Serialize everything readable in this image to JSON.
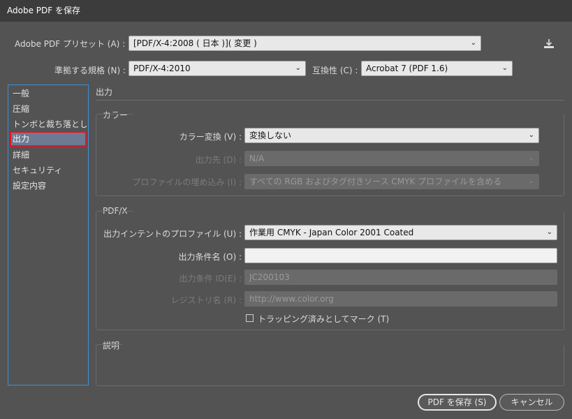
{
  "window": {
    "title": "Adobe PDF を保存"
  },
  "header": {
    "preset_label": "Adobe PDF プリセット (A) :",
    "preset_value": "[PDF/X-4:2008 ( 日本 )]( 変更 )",
    "standard_label": "準拠する規格 (N) :",
    "standard_value": "PDF/X-4:2010",
    "compat_label": "互換性 (C) :",
    "compat_value": "Acrobat 7 (PDF 1.6)",
    "save_preset_icon": "download-icon"
  },
  "sidebar": {
    "items": [
      {
        "label": "一般"
      },
      {
        "label": "圧縮"
      },
      {
        "label": "トンボと裁ち落とし"
      },
      {
        "label": "出力"
      },
      {
        "label": "詳細"
      },
      {
        "label": "セキュリティ"
      },
      {
        "label": "設定内容"
      }
    ],
    "active_index": 3
  },
  "main": {
    "section_title": "出力",
    "color": {
      "title": "カラー",
      "conversion_label": "カラー変換 (V) :",
      "conversion_value": "変換しない",
      "destination_label": "出力先 (D) :",
      "destination_value": "N/A",
      "profile_label": "プロファイルの埋め込み (I) :",
      "profile_value": "すべての RGB およびタグ付きソース CMYK プロファイルを含める"
    },
    "pdfx": {
      "title": "PDF/X",
      "intent_label": "出力インテントのプロファイル (U) :",
      "intent_value": "作業用 CMYK - Japan Color 2001 Coated",
      "condition_name_label": "出力条件名 (O) :",
      "condition_name_value": "",
      "condition_id_label": "出力条件 ID(E) :",
      "condition_id_value": "JC200103",
      "registry_label": "レジストリ名 (R) :",
      "registry_value": "http://www.color.org",
      "trapped_label": "トラッピング済みとしてマーク (T)"
    },
    "description": {
      "title": "説明"
    }
  },
  "footer": {
    "save_label": "PDF を保存 (S)",
    "cancel_label": "キャンセル"
  },
  "colors": {
    "accent": "#3d8fd6",
    "highlight_border": "#e8141c"
  }
}
